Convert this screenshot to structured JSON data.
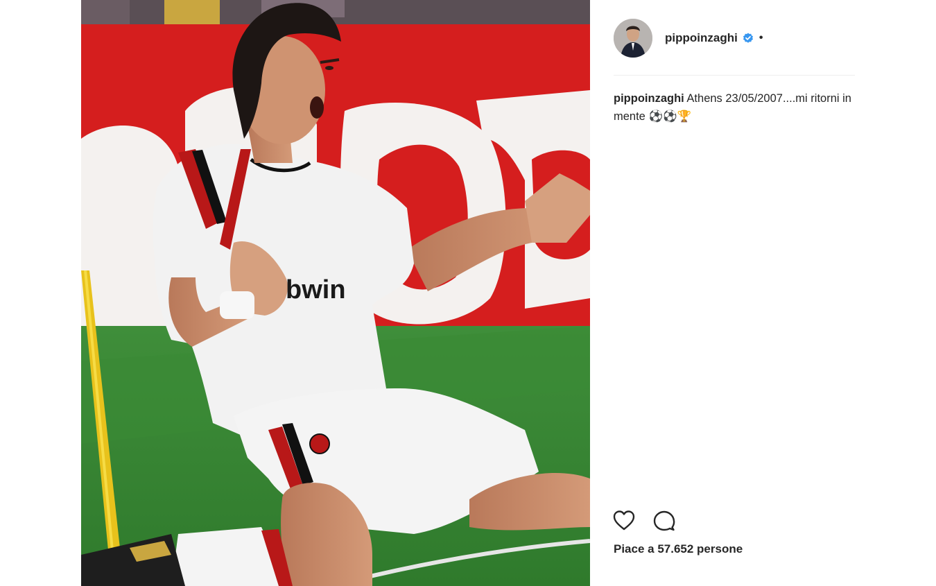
{
  "post": {
    "username": "pippoinzaghi",
    "verified": true,
    "separator": "•",
    "caption": {
      "username": "pippoinzaghi",
      "text": "Athens 23/05/2007....mi ritorni in mente ⚽⚽🏆"
    },
    "likes_text": "Piace a 57.652 persone"
  },
  "photo": {
    "jersey_sponsor": "bwin"
  },
  "icons": {
    "like": "heart-icon",
    "comment": "comment-icon",
    "verified": "verified-badge-icon"
  },
  "colors": {
    "verified_blue": "#3897f0",
    "text": "#262626",
    "divider": "#efefef"
  }
}
